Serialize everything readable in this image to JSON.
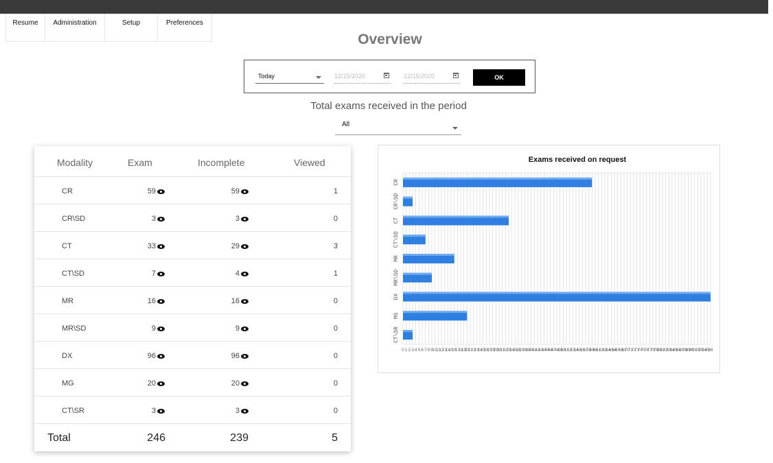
{
  "nav": {
    "items": [
      {
        "label": "Resume"
      },
      {
        "label": "Administration"
      },
      {
        "label": "Setup"
      },
      {
        "label": "Preferences"
      }
    ]
  },
  "page": {
    "title": "Overview",
    "subtitle": "Total exams received in the period"
  },
  "filters": {
    "period": "Today",
    "date_from": "12/15/2020",
    "date_to": "12/15/2020",
    "ok_label": "OK",
    "scope": "All"
  },
  "table": {
    "headers": {
      "modality": "Modality",
      "exam": "Exam",
      "incomplete": "Incomplete",
      "viewed": "Viewed"
    },
    "rows": [
      {
        "modality": "CR",
        "exam": "59",
        "incomplete": "59",
        "viewed": "1"
      },
      {
        "modality": "CR\\SD",
        "exam": "3",
        "incomplete": "3",
        "viewed": "0"
      },
      {
        "modality": "CT",
        "exam": "33",
        "incomplete": "29",
        "viewed": "3"
      },
      {
        "modality": "CT\\SD",
        "exam": "7",
        "incomplete": "4",
        "viewed": "1"
      },
      {
        "modality": "MR",
        "exam": "16",
        "incomplete": "16",
        "viewed": "0"
      },
      {
        "modality": "MR\\SD",
        "exam": "9",
        "incomplete": "9",
        "viewed": "0"
      },
      {
        "modality": "DX",
        "exam": "96",
        "incomplete": "96",
        "viewed": "0"
      },
      {
        "modality": "MG",
        "exam": "20",
        "incomplete": "20",
        "viewed": "0"
      },
      {
        "modality": "CT\\SR",
        "exam": "3",
        "incomplete": "3",
        "viewed": "0"
      }
    ],
    "total": {
      "label": "Total",
      "exam": "246",
      "incomplete": "239",
      "viewed": "5"
    }
  },
  "chart_data": {
    "type": "bar",
    "orientation": "horizontal",
    "title": "Exams received on request",
    "categories": [
      "CR",
      "CR\\SD",
      "CT",
      "CT\\SD",
      "MR",
      "MR\\SD",
      "DX",
      "MG",
      "CT\\SR"
    ],
    "values": [
      59,
      3,
      33,
      7,
      16,
      9,
      96,
      20,
      3
    ],
    "xlim": [
      0,
      96
    ],
    "grid": true,
    "bar_color": "#2f7fe0"
  }
}
